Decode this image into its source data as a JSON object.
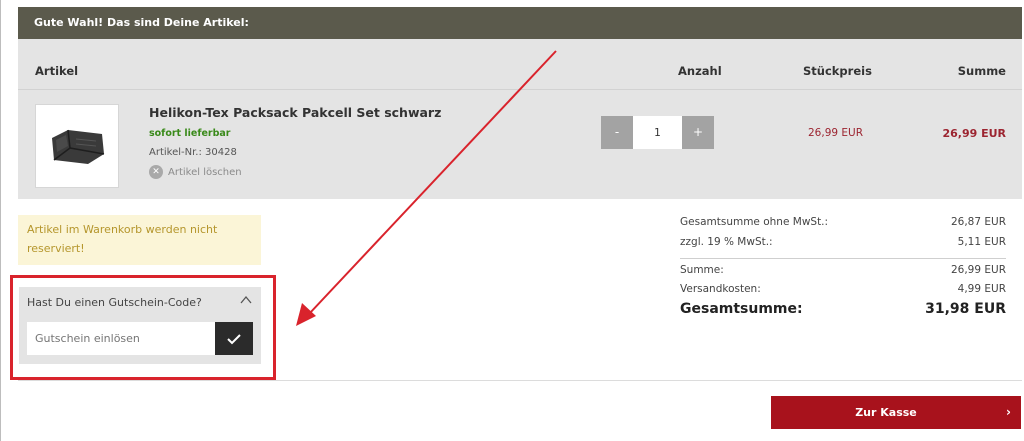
{
  "header": {
    "title": "Gute Wahl! Das sind Deine Artikel:"
  },
  "table": {
    "columns": [
      "Artikel",
      "Anzahl",
      "Stückpreis",
      "Summe"
    ],
    "item": {
      "name": "Helikon-Tex Packsack Pakcell Set schwarz",
      "availability": "sofort lieferbar",
      "article_number": "Artikel-Nr.: 30428",
      "delete_label": "Artikel löschen",
      "quantity": "1",
      "minus_label": "-",
      "plus_label": "+",
      "unit_price": "26,99 EUR",
      "total": "26,99 EUR"
    }
  },
  "notice": {
    "text": "Artikel im Warenkorb werden nicht reserviert!"
  },
  "summary": {
    "rows": [
      {
        "label": "Gesamtsumme ohne MwSt.:",
        "value": "26,87 EUR"
      },
      {
        "label": "zzgl. 19 % MwSt.:",
        "value": "5,11 EUR"
      },
      {
        "label": "Summe:",
        "value": "26,99 EUR"
      },
      {
        "label": "Versandkosten:",
        "value": "4,99 EUR"
      }
    ],
    "grand_total_label": "Gesamtsumme:",
    "grand_total_value": "31,98 EUR"
  },
  "voucher": {
    "title": "Hast Du einen Gutschein-Code?",
    "placeholder": "Gutschein einlösen"
  },
  "checkout": {
    "label": "Zur Kasse"
  },
  "colors": {
    "header_bg": "#5b5a4c",
    "price_red": "#9c2430",
    "availability_green": "#3a8a1a",
    "checkout_bg": "#a8121c",
    "annotation_red": "#d9232c"
  }
}
